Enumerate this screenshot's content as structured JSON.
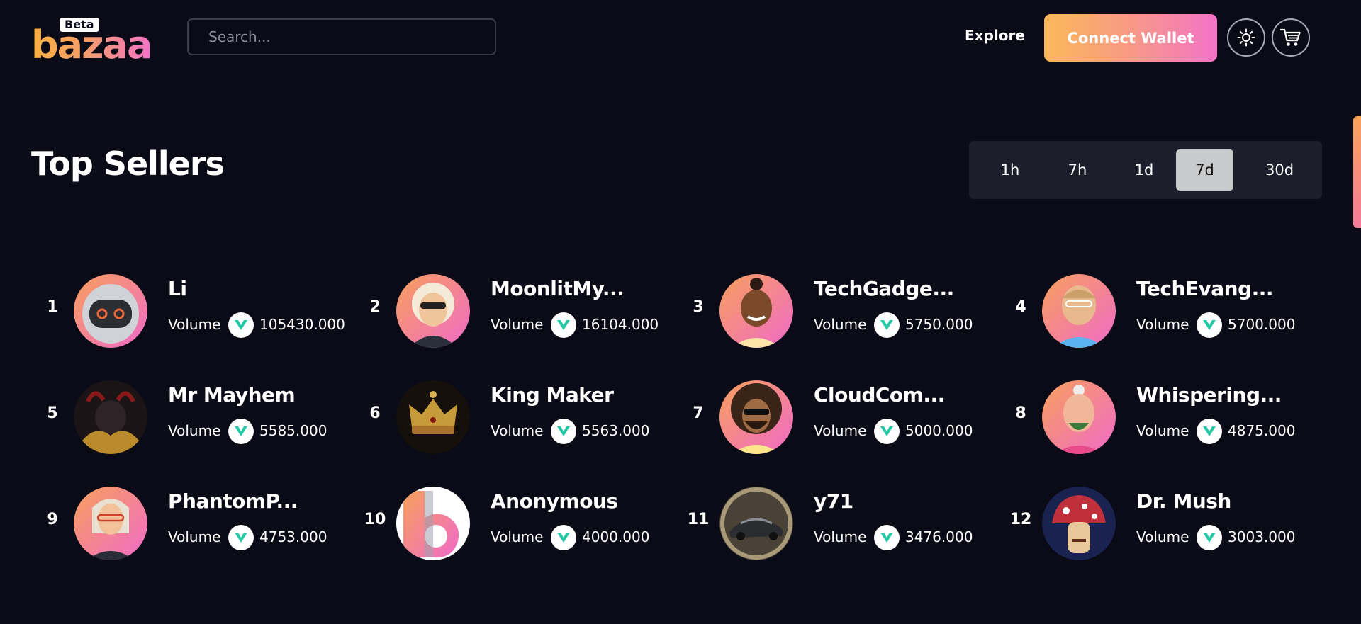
{
  "header": {
    "logo_badge": "Beta",
    "logo_text": "bazaa",
    "search_placeholder": "Search...",
    "explore_label": "Explore",
    "connect_label": "Connect Wallet",
    "theme_icon": "sun-icon",
    "cart_icon": "cart-icon"
  },
  "page": {
    "title": "Top Sellers"
  },
  "filters": {
    "tabs": [
      "1h",
      "7h",
      "1d",
      "7d",
      "30d"
    ],
    "active": "7d"
  },
  "volume_label": "Volume",
  "sellers": [
    {
      "rank": "1",
      "name": "Li",
      "volume": "105430.000"
    },
    {
      "rank": "2",
      "name": "MoonlitMy...",
      "volume": "16104.000"
    },
    {
      "rank": "3",
      "name": "TechGadge...",
      "volume": "5750.000"
    },
    {
      "rank": "4",
      "name": "TechEvang...",
      "volume": "5700.000"
    },
    {
      "rank": "5",
      "name": "Mr Mayhem",
      "volume": "5585.000"
    },
    {
      "rank": "6",
      "name": "King Maker",
      "volume": "5563.000"
    },
    {
      "rank": "7",
      "name": "CloudCom...",
      "volume": "5000.000"
    },
    {
      "rank": "8",
      "name": "Whispering...",
      "volume": "4875.000"
    },
    {
      "rank": "9",
      "name": "PhantomP...",
      "volume": "4753.000"
    },
    {
      "rank": "10",
      "name": "Anonymous",
      "volume": "4000.000"
    },
    {
      "rank": "11",
      "name": "y71",
      "volume": "3476.000"
    },
    {
      "rank": "12",
      "name": "Dr. Mush",
      "volume": "3003.000"
    }
  ],
  "colors": {
    "background": "#0a0b17",
    "accent_orange": "#fbb85a",
    "accent_pink": "#f472c8",
    "coin_teal": "#22c9a4"
  }
}
